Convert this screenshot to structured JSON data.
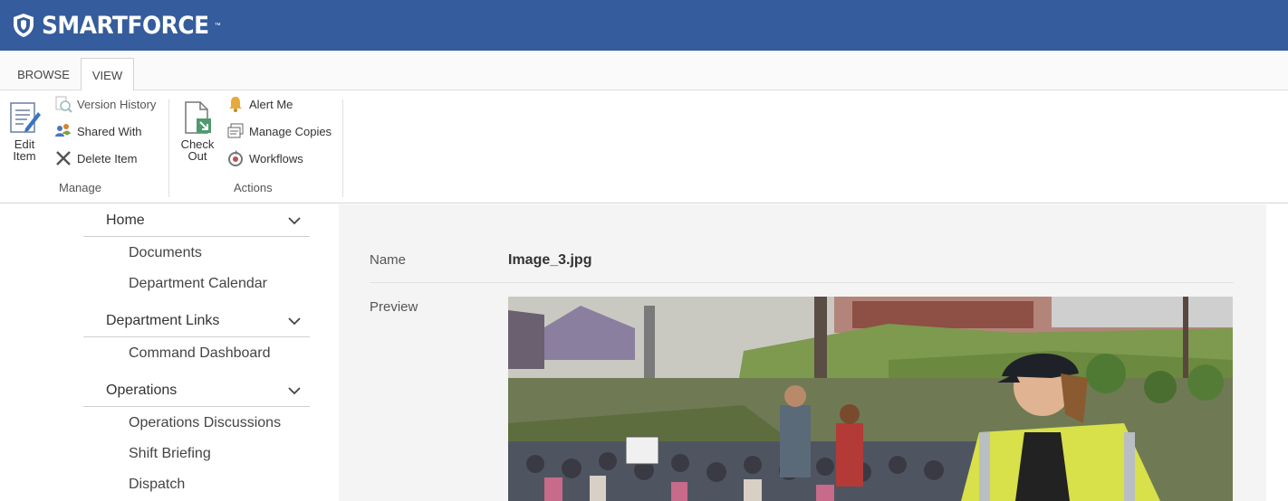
{
  "app": {
    "brand": "SMARTFORCE",
    "brand_mark": "™",
    "colors": {
      "suitebar": "#355c9c"
    }
  },
  "tabs": [
    {
      "label": "BROWSE"
    },
    {
      "label": "VIEW",
      "selected": true
    }
  ],
  "ribbon": {
    "manage": {
      "label": "Manage",
      "edit_item": "Edit\nItem",
      "edit_line1": "Edit",
      "edit_line2": "Item",
      "version_history": "Version History",
      "shared_with": "Shared With",
      "delete_item": "Delete Item"
    },
    "actions": {
      "label": "Actions",
      "check_line1": "Check",
      "check_line2": "Out",
      "alert_me": "Alert Me",
      "manage_copies": "Manage Copies",
      "workflows": "Workflows"
    }
  },
  "nav": {
    "sections": [
      {
        "header": "Home",
        "items": [
          "Documents",
          "Department Calendar"
        ]
      },
      {
        "header": "Department Links",
        "items": [
          "Command Dashboard"
        ]
      },
      {
        "header": "Operations",
        "items": [
          "Operations Discussions",
          "Shift Briefing",
          "Dispatch"
        ]
      }
    ]
  },
  "item": {
    "name_label": "Name",
    "name_value": "Image_3.jpg",
    "preview_label": "Preview",
    "preview_icon": "photo-preview"
  }
}
